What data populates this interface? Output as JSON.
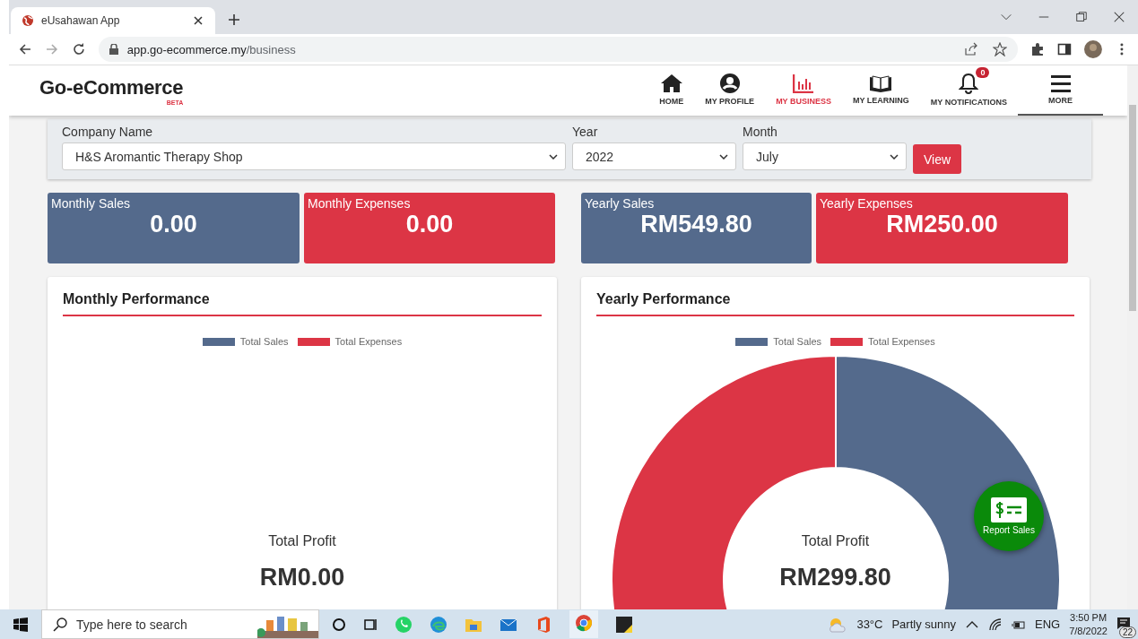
{
  "browser": {
    "tab_title": "eUsahawan App",
    "url_host": "app.go-ecommerce.my",
    "url_path": "/business"
  },
  "header": {
    "logo": "Go-eCommerce",
    "logo_badge": "BETA",
    "nav": [
      {
        "label": "HOME",
        "selected": false,
        "focused": false
      },
      {
        "label": "MY PROFILE",
        "selected": false,
        "focused": false
      },
      {
        "label": "MY BUSINESS",
        "selected": true,
        "focused": false
      },
      {
        "label": "MY LEARNING",
        "selected": false,
        "focused": false
      },
      {
        "label": "MY NOTIFICATIONS",
        "selected": false,
        "focused": false,
        "badge": "0"
      },
      {
        "label": "MORE",
        "selected": false,
        "focused": true
      }
    ]
  },
  "filters": {
    "company": {
      "label": "Company Name",
      "value": "H&S Aromantic Therapy Shop"
    },
    "year": {
      "label": "Year",
      "value": "2022"
    },
    "month": {
      "label": "Month",
      "value": "July"
    },
    "button": "View"
  },
  "stats": [
    {
      "label": "Monthly Sales",
      "value": "0.00",
      "kind": "sales"
    },
    {
      "label": "Monthly Expenses",
      "value": "0.00",
      "kind": "expenses"
    },
    {
      "label": "Yearly Sales",
      "value": "RM549.80",
      "kind": "sales"
    },
    {
      "label": "Yearly Expenses",
      "value": "RM250.00",
      "kind": "expenses"
    }
  ],
  "performance": [
    {
      "title": "Monthly Performance",
      "legend": [
        {
          "label": "Total Sales",
          "color": "#546a8c"
        },
        {
          "label": "Total Expenses",
          "color": "#dc3545"
        }
      ],
      "profit_label": "Total Profit",
      "profit_value": "RM0.00"
    },
    {
      "title": "Yearly Performance",
      "legend": [
        {
          "color": "#546a8c"
        },
        {
          "color": "#dc3545"
        }
      ],
      "profit_label": "Total Profit",
      "profit_value": "RM299.80",
      "chart_data": {
        "type": "donut",
        "categories": [
          "Total Sales",
          "Total Expenses"
        ],
        "values": [
          68.74,
          31.26
        ]
      }
    }
  ],
  "fab": {
    "label": "Report Sales"
  },
  "taskbar": {
    "search_placeholder": "Type here to search",
    "weather_temp": "33°C",
    "weather_text": "Partly sunny",
    "language": "ENG",
    "time": "3:50 PM",
    "date": "7/8/2022",
    "notifications": "22"
  }
}
